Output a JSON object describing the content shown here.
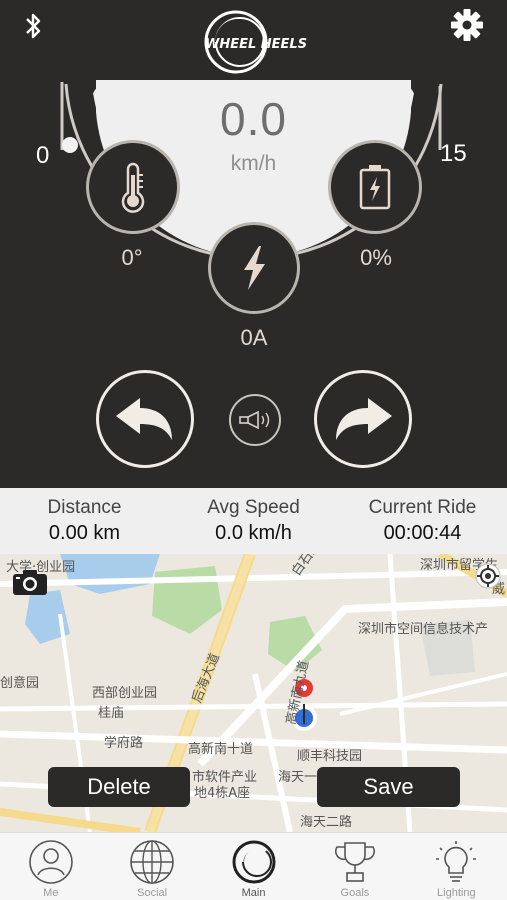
{
  "header": {
    "logo_text": "WHEEL HEELS"
  },
  "speedometer": {
    "speed": "0.0",
    "unit": "km/h",
    "scale_min": "0",
    "scale_max": "15"
  },
  "gauges": {
    "temperature": "0°",
    "battery": "0%",
    "current": "0A"
  },
  "stats": {
    "distance_label": "Distance",
    "distance_value": "0.00 km",
    "avg_speed_label": "Avg Speed",
    "avg_speed_value": "0.0 km/h",
    "current_ride_label": "Current Ride",
    "current_ride_value": "00:00:44"
  },
  "map": {
    "labels": {
      "l1": "大学·创业园",
      "l2": "深圳市留学生",
      "l3": "白石路",
      "l4": "深圳市空间信息技术产",
      "l5": "创意园",
      "l6": "西部创业园",
      "l7": "桂庙",
      "l8": "后海大道",
      "l9": "学府路",
      "l10": "高新南十道",
      "l11": "顺丰科技园",
      "l12": "市软件产业",
      "l13": "地4栋A座",
      "l14": "海天一",
      "l15": "海天二路",
      "l16": "高新南九道",
      "l17": "威"
    },
    "delete_label": "Delete",
    "save_label": "Save"
  },
  "tabs": [
    {
      "label": "Me"
    },
    {
      "label": "Social"
    },
    {
      "label": "Main"
    },
    {
      "label": "Goals"
    },
    {
      "label": "Lighting"
    }
  ]
}
